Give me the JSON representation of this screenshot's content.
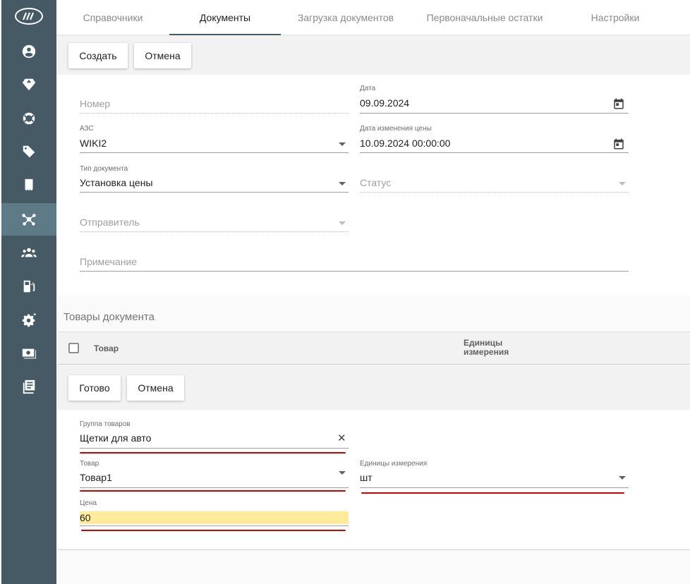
{
  "sidebar": {
    "items": [
      {
        "icon": "logo-icon"
      },
      {
        "icon": "account-icon"
      },
      {
        "icon": "diamond-icon"
      },
      {
        "icon": "lifebuoy-icon"
      },
      {
        "icon": "tag-icon"
      },
      {
        "icon": "receipt-icon"
      },
      {
        "icon": "network-icon",
        "active": true
      },
      {
        "icon": "users-icon"
      },
      {
        "icon": "fuel-icon"
      },
      {
        "icon": "gear-icon"
      },
      {
        "icon": "cash-icon"
      },
      {
        "icon": "journal-icon"
      }
    ]
  },
  "tabs": [
    "Справочники",
    "Документы",
    "Загрузка документов",
    "Первоначальные остатки",
    "Настройки"
  ],
  "toolbar": {
    "create_label": "Создать",
    "cancel_label": "Отмена"
  },
  "form": {
    "number_placeholder": "Номер",
    "date_label": "Дата",
    "date_value": "09.09.2024",
    "station_label": "АЗС",
    "station_value": "WIKI2",
    "price_change_date_label": "Дата изменения цены",
    "price_change_date_value": "10.09.2024 00:00:00",
    "doc_type_label": "Тип документа",
    "doc_type_value": "Установка цены",
    "status_placeholder": "Статус",
    "sender_placeholder": "Отправитель",
    "note_placeholder": "Примечание"
  },
  "goods_section": {
    "title": "Товары документа",
    "col_product": "Товар",
    "col_units_line1": "Единицы",
    "col_units_line2": "измерения"
  },
  "goods_toolbar": {
    "done_label": "Готово",
    "cancel_label": "Отмена"
  },
  "goods_form": {
    "group_label": "Группа товаров",
    "group_value": "Щетки для авто",
    "product_label": "Товар",
    "product_value": "Товар1",
    "units_label": "Единицы измерения",
    "units_value": "шт",
    "price_label": "Цена",
    "price_value": "60"
  },
  "colors": {
    "sidebar": "#455a64",
    "sidebar_active": "#5f7a87",
    "annotation_red": "#d50000",
    "price_highlight": "#ffeb99"
  }
}
